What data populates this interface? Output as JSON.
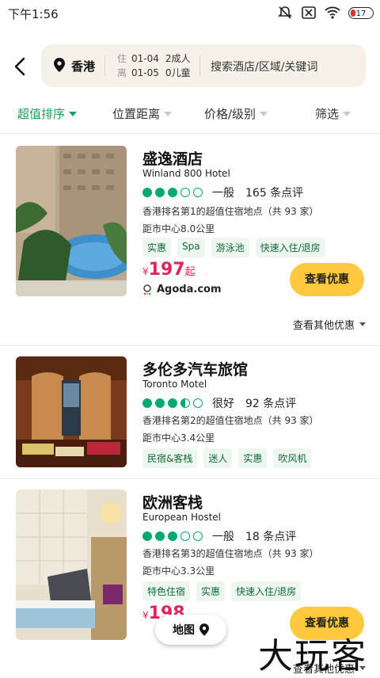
{
  "status_bar": {
    "time": "下午1:56",
    "battery": "17"
  },
  "search": {
    "city": "香港",
    "checkin_label": "住",
    "checkin_date": "01-04",
    "checkout_label": "离",
    "checkout_date": "01-05",
    "adults": "2成人",
    "children": "0儿童",
    "keyword_placeholder": "搜索酒店/区域/关键词"
  },
  "sort_tabs": [
    {
      "label": "超值排序",
      "active": true
    },
    {
      "label": "位置距离",
      "active": false
    },
    {
      "label": "价格/级别",
      "active": false
    },
    {
      "label": "筛选",
      "active": false
    }
  ],
  "hotels": [
    {
      "name": "盛逸酒店",
      "name_en": "Winland 800 Hotel",
      "rating_level": "一般",
      "review_count": "165 条点评",
      "rank_text": "香港排名第1的超值住宿地点（共 93 家）",
      "distance": "距市中心8.0公里",
      "tags": [
        "实惠",
        "Spa",
        "游泳池",
        "快速入住/退房"
      ],
      "price_symbol": "¥",
      "price": "197",
      "price_suffix": "起",
      "vendor": "Agoda.com",
      "deal_button": "查看优惠",
      "more_deals": "查看其他优惠"
    },
    {
      "name": "多伦多汽车旅馆",
      "name_en": "Toronto Motel",
      "rating_level": "很好",
      "review_count": "92 条点评",
      "rank_text": "香港排名第2的超值住宿地点（共 93 家）",
      "distance": "距市中心3.4公里",
      "tags": [
        "民宿&客栈",
        "迷人",
        "实惠",
        "吹风机"
      ]
    },
    {
      "name": "欧洲客栈",
      "name_en": "European Hostel",
      "rating_level": "一般",
      "review_count": "18 条点评",
      "rank_text": "香港排名第3的超值住宿地点（共 93 家）",
      "distance": "距市中心3.3公里",
      "tags": [
        "特色住宿",
        "实惠",
        "快速入住/退房"
      ],
      "price_symbol": "¥",
      "price": "198",
      "deal_button": "查看优惠",
      "more_deals": "查看其他优惠"
    }
  ],
  "map_button": "地图",
  "watermark": "大玩客"
}
